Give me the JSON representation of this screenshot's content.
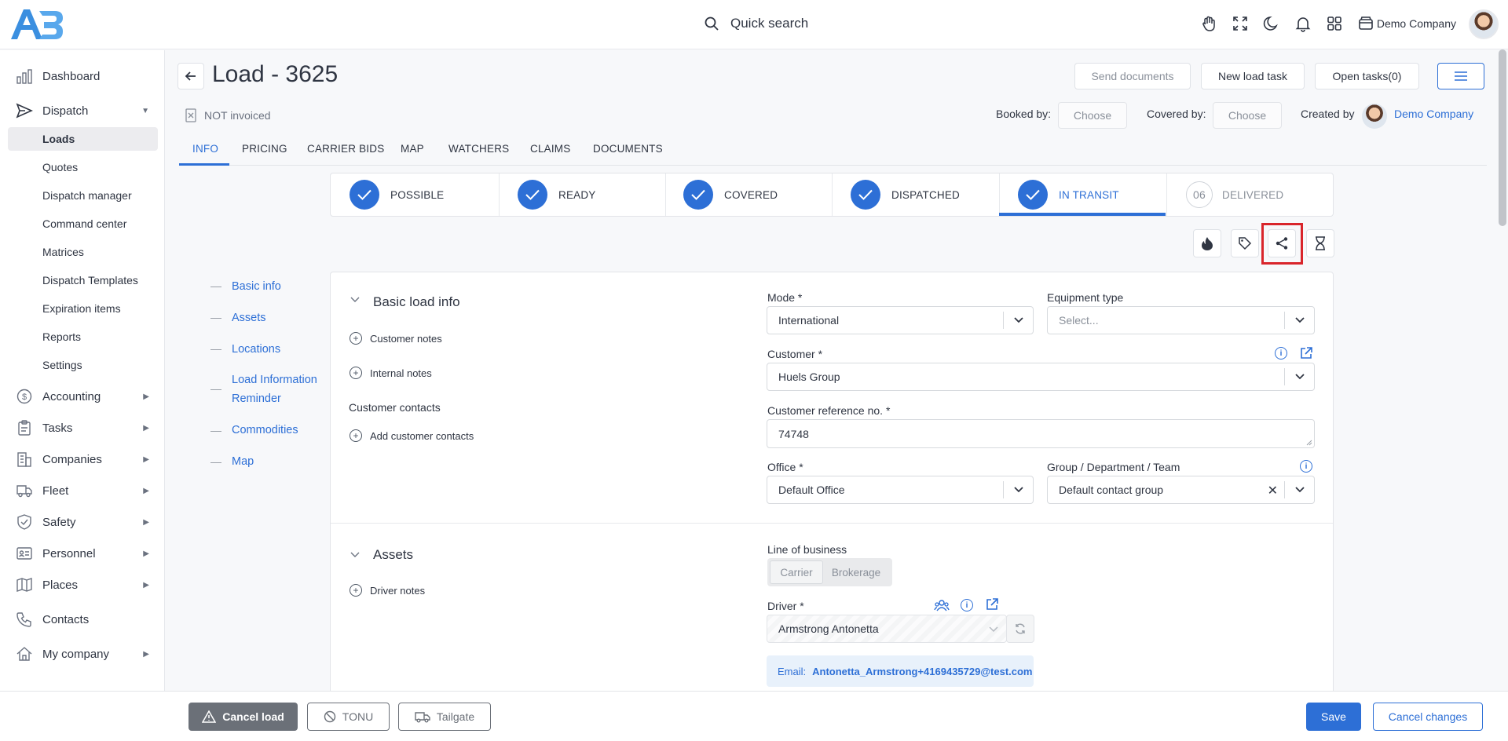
{
  "header": {
    "search_label": "Quick search",
    "company_name": "Demo Company"
  },
  "sidebar": {
    "items": [
      {
        "label": "Dashboard"
      },
      {
        "label": "Dispatch"
      },
      {
        "label": "Accounting"
      },
      {
        "label": "Tasks"
      },
      {
        "label": "Companies"
      },
      {
        "label": "Fleet"
      },
      {
        "label": "Safety"
      },
      {
        "label": "Personnel"
      },
      {
        "label": "Places"
      },
      {
        "label": "Contacts"
      },
      {
        "label": "My company"
      }
    ],
    "dispatch_sub": [
      {
        "label": "Loads"
      },
      {
        "label": "Quotes"
      },
      {
        "label": "Dispatch manager"
      },
      {
        "label": "Command center"
      },
      {
        "label": "Matrices"
      },
      {
        "label": "Dispatch Templates"
      },
      {
        "label": "Expiration items"
      },
      {
        "label": "Reports"
      },
      {
        "label": "Settings"
      }
    ]
  },
  "page": {
    "title": "Load - 3625",
    "invoice_status": "NOT invoiced",
    "send_documents": "Send documents",
    "new_load_task": "New load task",
    "open_tasks": "Open tasks(0)",
    "booked_by_label": "Booked by:",
    "booked_by_value": "Choose",
    "covered_by_label": "Covered by:",
    "covered_by_value": "Choose",
    "created_by_label": "Created by",
    "created_by_value": "Demo Company"
  },
  "tabs": [
    "INFO",
    "PRICING",
    "CARRIER BIDS",
    "MAP",
    "WATCHERS",
    "CLAIMS",
    "DOCUMENTS"
  ],
  "steps": [
    {
      "label": "POSSIBLE",
      "done": true
    },
    {
      "label": "READY",
      "done": true
    },
    {
      "label": "COVERED",
      "done": true
    },
    {
      "label": "DISPATCHED",
      "done": true
    },
    {
      "label": "IN TRANSIT",
      "done": true
    },
    {
      "label": "DELIVERED",
      "num": "06"
    }
  ],
  "anchors": [
    "Basic info",
    "Assets",
    "Locations",
    "Load Information",
    "Reminder",
    "Commodities",
    "Map"
  ],
  "basic": {
    "title": "Basic load info",
    "customer_notes": "Customer notes",
    "internal_notes": "Internal notes",
    "customer_contacts": "Customer contacts",
    "add_customer_contacts": "Add customer contacts",
    "mode_label": "Mode *",
    "mode_value": "International",
    "equipment_label": "Equipment type",
    "equipment_placeholder": "Select...",
    "customer_label": "Customer *",
    "customer_value": "Huels Group",
    "ref_label": "Customer reference no. *",
    "ref_value": "74748",
    "office_label": "Office *",
    "office_value": "Default Office",
    "group_label": "Group / Department / Team",
    "group_value": "Default contact group"
  },
  "assets": {
    "title": "Assets",
    "driver_notes": "Driver notes",
    "lob_label": "Line of business",
    "lob_options": [
      "Carrier",
      "Brokerage"
    ],
    "driver_label": "Driver *",
    "driver_value": "Armstrong Antonetta",
    "email_label": "Email:",
    "email_value": "Antonetta_Armstrong+4169435729@test.com"
  },
  "footer": {
    "cancel_load": "Cancel load",
    "tonu": "TONU",
    "tailgate": "Tailgate",
    "save": "Save",
    "cancel_changes": "Cancel changes"
  },
  "colors": {
    "accent": "#2d6fd6",
    "highlight": "#d9252b",
    "cancel_load_bg": "#6b7078"
  }
}
